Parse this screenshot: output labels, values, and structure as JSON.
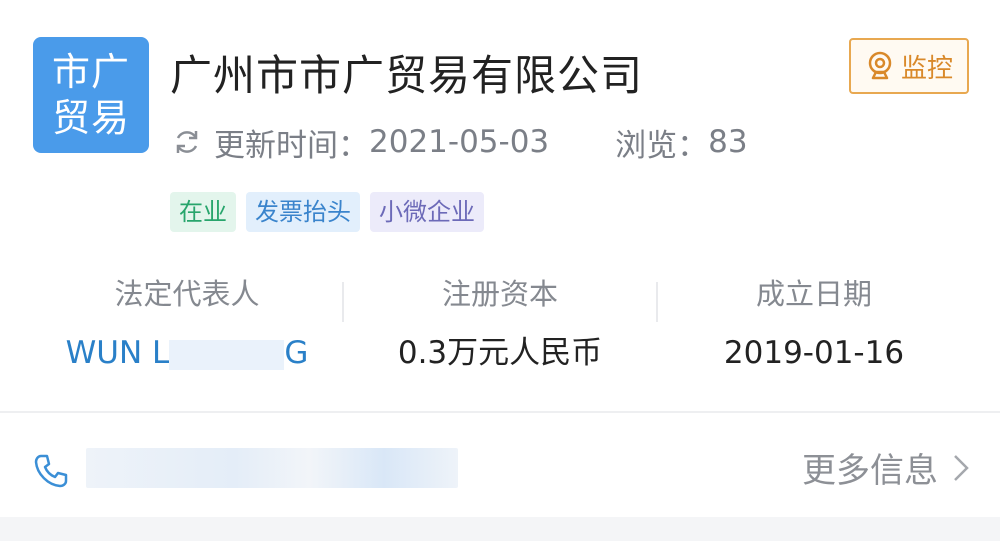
{
  "company": {
    "logo_line1": "市广",
    "logo_line2": "贸易",
    "name": "广州市市广贸易有限公司",
    "monitor_label": "监控",
    "update_label": "更新时间：",
    "update_date": "2021-05-03",
    "views_label": "浏览：",
    "views_count": "83"
  },
  "tags": [
    {
      "label": "在业",
      "color": "#28a56c"
    },
    {
      "label": "发票抬头",
      "color": "#3a84cc"
    },
    {
      "label": "小微企业",
      "color": "#6c6ab8"
    }
  ],
  "info": {
    "legal_rep_label": "法定代表人",
    "legal_rep_value_start": "WUN L",
    "legal_rep_value_end": "G",
    "capital_label": "注册资本",
    "capital_value": "0.3万元人民币",
    "founded_label": "成立日期",
    "founded_value": "2019-01-16"
  },
  "contact": {
    "more_info_label": "更多信息"
  },
  "colors": {
    "accent_blue": "#4a9bea",
    "monitor_orange": "#e8a850",
    "link_blue": "#2a80c8"
  }
}
